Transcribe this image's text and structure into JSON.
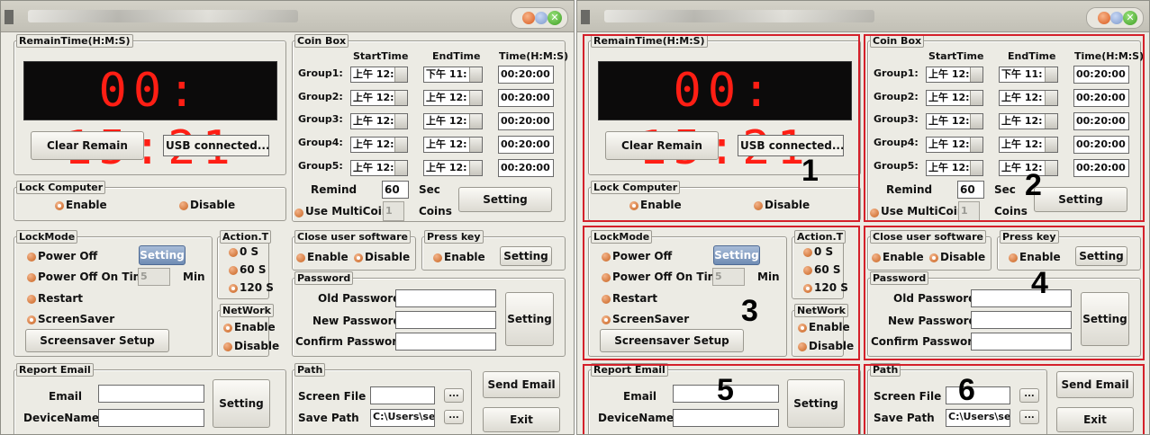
{
  "panels": [
    {
      "remain_legend": "RemainTime(H:M:S)",
      "remain_time": "00: 15:21",
      "clear_remain": "Clear Remain",
      "usb_status": "USB connected...",
      "lock_legend": "Lock Computer",
      "lock_enable": "Enable",
      "lock_disable": "Disable",
      "coin_legend": "Coin Box",
      "col_start": "StartTime",
      "col_end": "EndTime",
      "col_time": "Time(H:M:S)",
      "groups": [
        {
          "label": "Group1:",
          "start": "上午 12:",
          "end": "下午 11:",
          "time": "00:20:00"
        },
        {
          "label": "Group2:",
          "start": "上午 12:",
          "end": "上午 12:",
          "time": "00:20:00"
        },
        {
          "label": "Group3:",
          "start": "上午 12:",
          "end": "上午 12:",
          "time": "00:20:00"
        },
        {
          "label": "Group4:",
          "start": "上午 12:",
          "end": "上午 12:",
          "time": "00:20:00"
        },
        {
          "label": "Group5:",
          "start": "上午 12:",
          "end": "上午 12:",
          "time": "00:20:00"
        }
      ],
      "remind": "Remind",
      "remind_value": "60",
      "sec": "Sec",
      "coin_setting": "Setting",
      "multicoin": "Use MultiCoin",
      "multicoin_value": "1",
      "coins": "Coins",
      "lockmode_legend": "LockMode",
      "power_off": "Power Off",
      "lockmode_setting": "Setting",
      "power_off_on_time": "Power Off On Time",
      "power_off_value": "5",
      "min": "Min",
      "restart": "Restart",
      "screensaver": "ScreenSaver",
      "screensaver_setup": "Screensaver Setup",
      "action_legend": "Action.T",
      "action_0": "0 S",
      "action_60": "60 S",
      "action_120": "120 S",
      "network_legend": "NetWork",
      "net_enable": "Enable",
      "net_disable": "Disable",
      "close_legend": "Close user software",
      "close_enable": "Enable",
      "close_disable": "Disable",
      "press_legend": "Press key",
      "press_enable": "Enable",
      "press_setting": "Setting",
      "password_legend": "Password",
      "old_password": "Old Password:",
      "new_password": "New Password:",
      "confirm_password": "Confirm Password:",
      "password_setting": "Setting",
      "report_legend": "Report Email",
      "email": "Email",
      "device_name": "DeviceName",
      "report_setting": "Setting",
      "path_legend": "Path",
      "screen_file": "Screen File",
      "save_path": "Save Path",
      "save_path_value": "C:\\Users\\sea",
      "browse": "...",
      "send_email": "Send Email",
      "exit": "Exit"
    },
    {
      "remain_legend": "RemainTime(H:M:S)",
      "remain_time": "00: 15:21",
      "clear_remain": "Clear Remain",
      "usb_status": "USB connected...",
      "lock_legend": "Lock Computer",
      "lock_enable": "Enable",
      "lock_disable": "Disable",
      "coin_legend": "Coin Box",
      "col_start": "StartTime",
      "col_end": "EndTime",
      "col_time": "Time(H:M:S)",
      "groups": [
        {
          "label": "Group1:",
          "start": "上午 12:",
          "end": "下午 11:",
          "time": "00:20:00"
        },
        {
          "label": "Group2:",
          "start": "上午 12:",
          "end": "上午 12:",
          "time": "00:20:00"
        },
        {
          "label": "Group3:",
          "start": "上午 12:",
          "end": "上午 12:",
          "time": "00:20:00"
        },
        {
          "label": "Group4:",
          "start": "上午 12:",
          "end": "上午 12:",
          "time": "00:20:00"
        },
        {
          "label": "Group5:",
          "start": "上午 12:",
          "end": "上午 12:",
          "time": "00:20:00"
        }
      ],
      "remind": "Remind",
      "remind_value": "60",
      "sec": "Sec",
      "coin_setting": "Setting",
      "multicoin": "Use MultiCoin",
      "multicoin_value": "1",
      "coins": "Coins",
      "lockmode_legend": "LockMode",
      "power_off": "Power Off",
      "lockmode_setting": "Setting",
      "power_off_on_time": "Power Off On Time",
      "power_off_value": "5",
      "min": "Min",
      "restart": "Restart",
      "screensaver": "ScreenSaver",
      "screensaver_setup": "Screensaver Setup",
      "action_legend": "Action.T",
      "action_0": "0 S",
      "action_60": "60 S",
      "action_120": "120 S",
      "network_legend": "NetWork",
      "net_enable": "Enable",
      "net_disable": "Disable",
      "close_legend": "Close user software",
      "close_enable": "Enable",
      "close_disable": "Disable",
      "press_legend": "Press key",
      "press_enable": "Enable",
      "press_setting": "Setting",
      "password_legend": "Password",
      "old_password": "Old Password:",
      "new_password": "New Password:",
      "confirm_password": "Confirm Password:",
      "password_setting": "Setting",
      "report_legend": "Report Email",
      "email": "Email",
      "device_name": "DeviceName",
      "report_setting": "Setting",
      "path_legend": "Path",
      "screen_file": "Screen File",
      "save_path": "Save Path",
      "save_path_value": "C:\\Users\\sea",
      "browse": "...",
      "send_email": "Send Email",
      "exit": "Exit"
    }
  ],
  "annotations": {
    "numbers": [
      "1",
      "2",
      "3",
      "4",
      "5",
      "6"
    ],
    "box_color": "#d4202a"
  },
  "icons": {
    "window_controls": [
      "minimize-icon",
      "maximize-icon",
      "close-icon"
    ],
    "close_glyph": "✕"
  }
}
